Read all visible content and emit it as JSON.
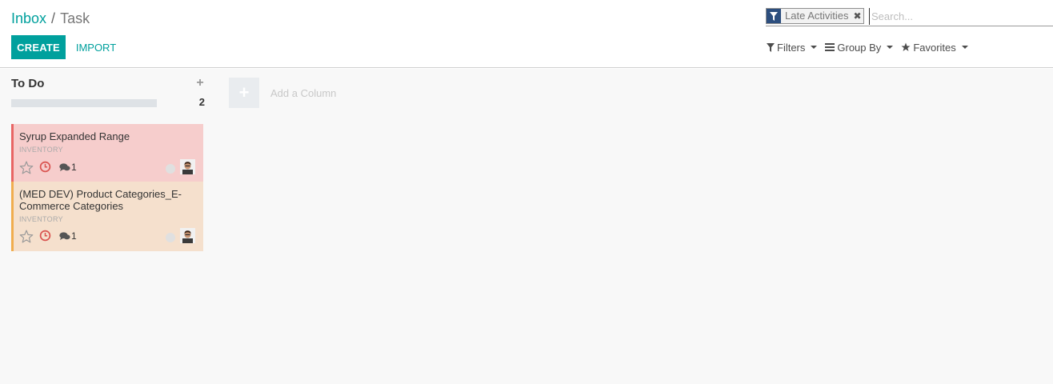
{
  "breadcrumb": {
    "parent": "Inbox",
    "separator": "/",
    "current": "Task"
  },
  "actions": {
    "create_label": "CREATE",
    "import_label": "IMPORT"
  },
  "search": {
    "facet_label": "Late Activities",
    "facet_icon": "filter-icon",
    "placeholder": "Search...",
    "value": ""
  },
  "search_options": {
    "filters_label": "Filters",
    "group_by_label": "Group By",
    "favorites_label": "Favorites"
  },
  "kanban": {
    "column": {
      "title": "To Do",
      "count": "2",
      "add_icon": "+"
    },
    "cards": [
      {
        "title": "Syrup Expanded Range",
        "tag": "INVENTORY",
        "messages": "1",
        "status": "late",
        "accent": "#e86564"
      },
      {
        "title": "(MED DEV) Product Categories_E-Commerce Categories",
        "tag": "INVENTORY",
        "messages": "1",
        "status": "late",
        "accent": "#f0ad4e"
      }
    ],
    "add_column": {
      "icon": "+",
      "label": "Add a Column"
    }
  },
  "colors": {
    "primary": "#00a09d",
    "facet_icon_bg": "#2c4e7e",
    "card_late_bg": "#f6cdcc",
    "card_warning_bg": "#f5e0cd",
    "activity_late": "#d9534f"
  }
}
